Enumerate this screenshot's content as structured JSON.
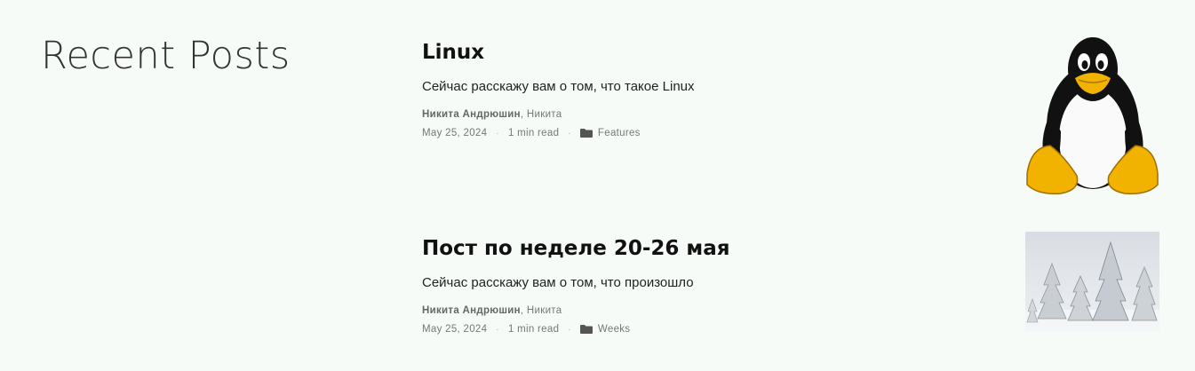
{
  "section": {
    "title": "Recent Posts"
  },
  "posts": [
    {
      "title": "Linux",
      "excerpt": "Сейчас расскажу вам о том, что такое Linux",
      "author_primary": "Никита Андрюшин",
      "author_secondary": "Никита",
      "date": "May 25, 2024",
      "read_time": "1 min read",
      "category": "Features",
      "thumbnail_icon": "tux-penguin-image"
    },
    {
      "title": "Пост по неделе 20-26 мая",
      "excerpt": "Сейчас расскажу вам о том, что произошло",
      "author_primary": "Никита Андрюшин",
      "author_secondary": "Никита",
      "date": "May 25, 2024",
      "read_time": "1 min read",
      "category": "Weeks",
      "thumbnail_icon": "snowy-forest-image"
    }
  ],
  "meta": {
    "separator": "·",
    "author_separator": ", "
  },
  "colors": {
    "background": "#f6fbf8",
    "title": "#111111",
    "meta": "#777777"
  }
}
